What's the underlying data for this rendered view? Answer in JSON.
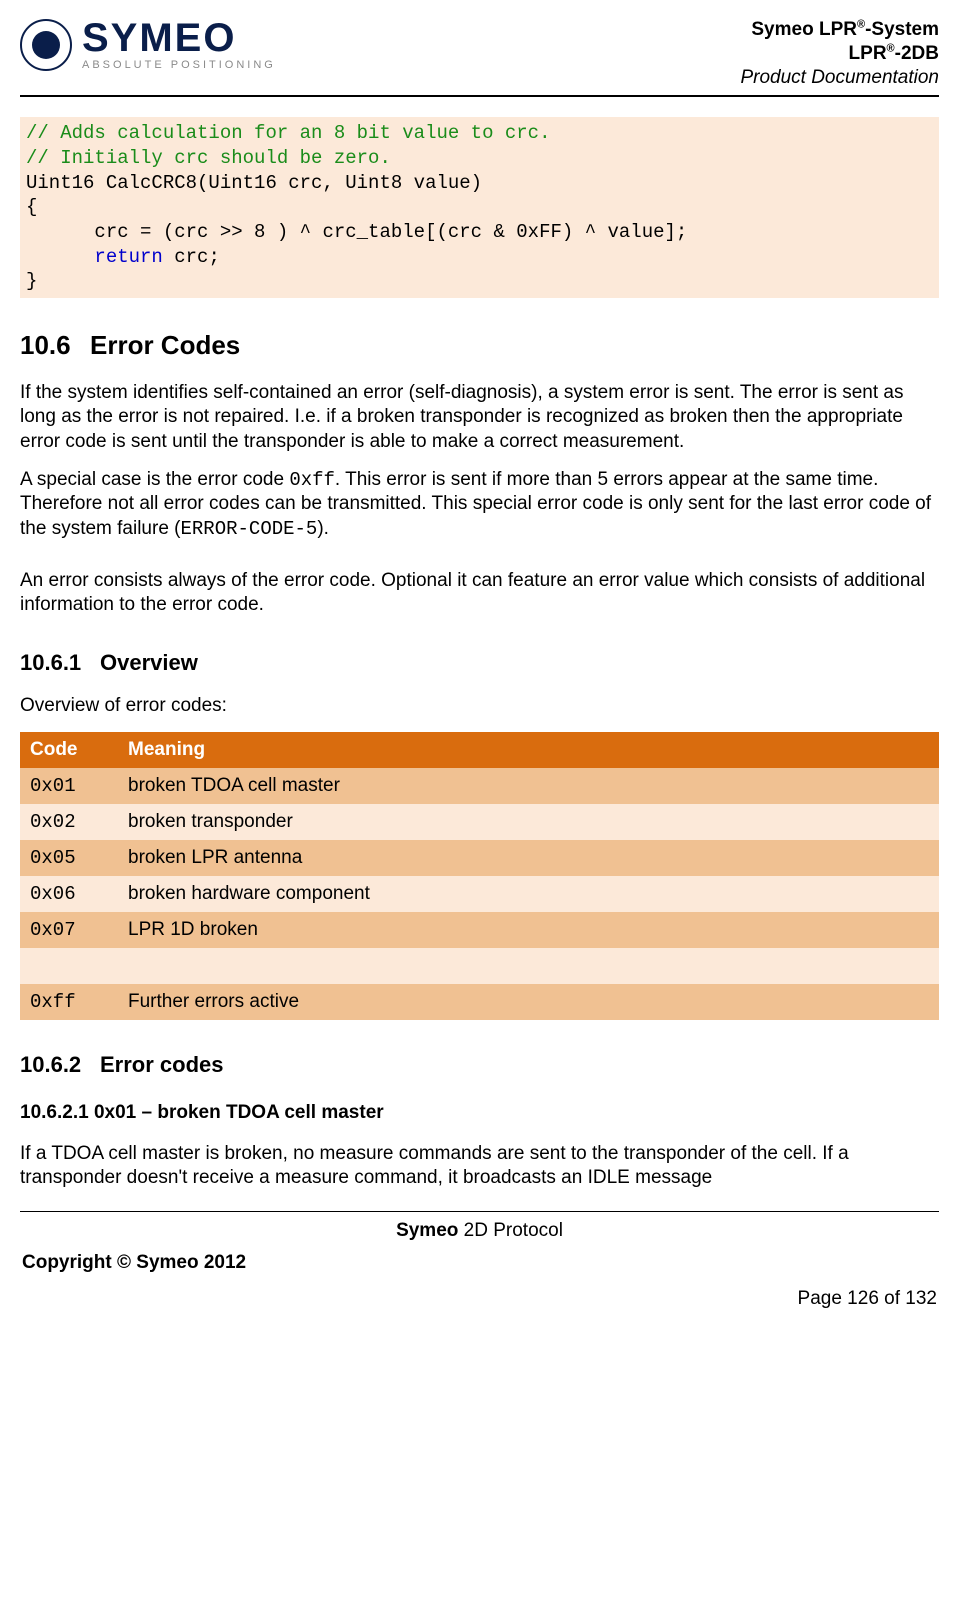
{
  "header": {
    "logo_word": "SYMEO",
    "logo_sub": "ABSOLUTE POSITIONING",
    "line1_pre": "Symeo LPR",
    "line1_sup": "®",
    "line1_post": "-System",
    "line2_pre": "LPR",
    "line2_sup": "®",
    "line2_post": "-2DB",
    "line3": "Product Documentation"
  },
  "code": {
    "c1": "// Adds calculation for an 8 bit value to crc.",
    "c2": "// Initially crc should be zero.",
    "l3": "Uint16 CalcCRC8(Uint16 crc, Uint8 value)",
    "l4": "{",
    "l5": "      crc = (crc >> 8 ) ^ crc_table[(crc & 0xFF) ^ value];",
    "l6a": "      ",
    "l6b": "return",
    "l6c": " crc;",
    "l7": "}"
  },
  "section": {
    "num": "10.6",
    "title": "Error Codes"
  },
  "para1a": "If the system identifies self-contained an error (self-diagnosis), a system error is sent. The error is sent as long as the error is not repaired. I.e. if a broken transponder is recognized as broken then the appropriate error code is sent until the transponder is able to make a correct measurement.",
  "para2a": "A special case is the error code ",
  "para2b": "0xff",
  "para2c": ". This error is sent if more than 5 errors appear at the same time. Therefore not all error codes can be transmitted. This special error code is only sent for the last error code of the system failure (",
  "para2d": "ERROR-CODE-5",
  "para2e": ").",
  "para3": "An error consists always of the error code. Optional it can feature an error value which consists of additional information to the error code.",
  "sub1": {
    "num": "10.6.1",
    "title": "Overview"
  },
  "overview_intro": "Overview of error codes:",
  "table": {
    "h1": "Code",
    "h2": "Meaning",
    "rows": [
      {
        "code": "0x01",
        "meaning": "broken TDOA cell master"
      },
      {
        "code": "0x02",
        "meaning": "broken transponder"
      },
      {
        "code": "0x05",
        "meaning": "broken LPR antenna"
      },
      {
        "code": "0x06",
        "meaning": "broken hardware component"
      },
      {
        "code": "0x07",
        "meaning": "LPR 1D broken"
      },
      {
        "code": "",
        "meaning": ""
      },
      {
        "code": "0xff",
        "meaning": "Further errors active"
      }
    ]
  },
  "sub2": {
    "num": "10.6.2",
    "title": "Error codes"
  },
  "sub2_1_heading": "10.6.2.1 0x01 – broken TDOA cell master",
  "sub2_1_para": "If a TDOA cell master is broken, no measure commands are sent to the transponder of the cell. If a transponder doesn't receive a measure command, it broadcasts an IDLE message",
  "footer": {
    "center_b": "Symeo",
    "center_rest": " 2D Protocol",
    "copyright": "Copyright © Symeo 2012",
    "page": "Page 126 of 132"
  }
}
